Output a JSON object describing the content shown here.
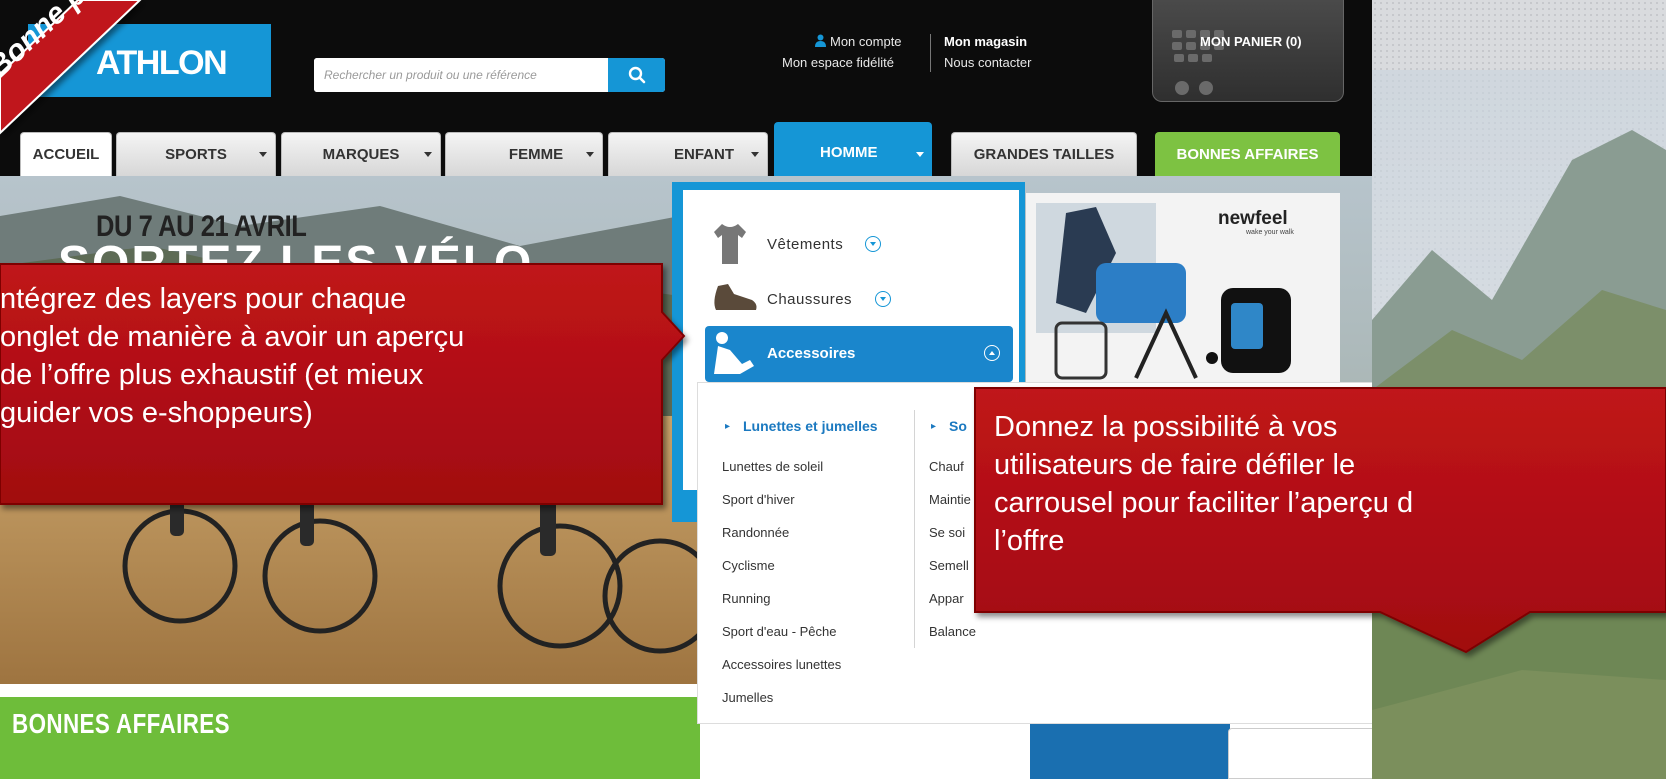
{
  "banner": {
    "label": "Bonne pra"
  },
  "header": {
    "logo_text": "ATHLON",
    "search": {
      "placeholder": "Rechercher un produit ou une référence"
    },
    "links": {
      "account": "Mon compte",
      "loyalty": "Mon espace fidélité",
      "store": "Mon magasin",
      "contact": "Nous contacter"
    },
    "cart_label": "MON PANIER (0)"
  },
  "nav": {
    "tabs": [
      {
        "label": "ACCUEIL"
      },
      {
        "label": "SPORTS"
      },
      {
        "label": "MARQUES"
      },
      {
        "label": "FEMME"
      },
      {
        "label": "ENFANT"
      },
      {
        "label": "HOMME"
      },
      {
        "label": "GRANDES TAILLES"
      },
      {
        "label": "BONNES AFFAIRES"
      }
    ]
  },
  "hero": {
    "date": "DU 7 AU 21 AVRIL",
    "partial_title": "SORTEZ LES VÉLO"
  },
  "section": {
    "bonnes_affaires": "BONNES AFFAIRES"
  },
  "menu": {
    "categories": [
      {
        "label": "Vêtements"
      },
      {
        "label": "Chaussures"
      },
      {
        "label": "Accessoires"
      }
    ],
    "promo": {
      "brand": "newfeel",
      "tagline": "wake your walk"
    },
    "column1": {
      "heading": "Lunettes et jumelles",
      "items": [
        "Lunettes de soleil",
        "Sport d'hiver",
        "Randonnée",
        "Cyclisme",
        "Running",
        "Sport d'eau - Pêche",
        "Accessoires lunettes",
        "Jumelles"
      ]
    },
    "column2": {
      "heading": "So",
      "items": [
        "Chauf",
        "Maintie",
        "Se soi",
        "Semell",
        "Appar",
        "Balance"
      ]
    }
  },
  "callouts": {
    "left": [
      "ntégrez des layers pour chaque",
      "onglet de manière à avoir un aperçu",
      "de l’offre plus exhaustif (et mieux",
      "guider vos e-shoppeurs)"
    ],
    "right": [
      "Donnez la possibilité à vos",
      "utilisateurs de faire défiler le",
      "carrousel pour faciliter l’aperçu d",
      "l’offre"
    ]
  },
  "colors": {
    "brand_blue": "#1596d6",
    "green": "#7dc242",
    "callout_red": "#b00b10",
    "header_black": "#0c0c0c"
  }
}
